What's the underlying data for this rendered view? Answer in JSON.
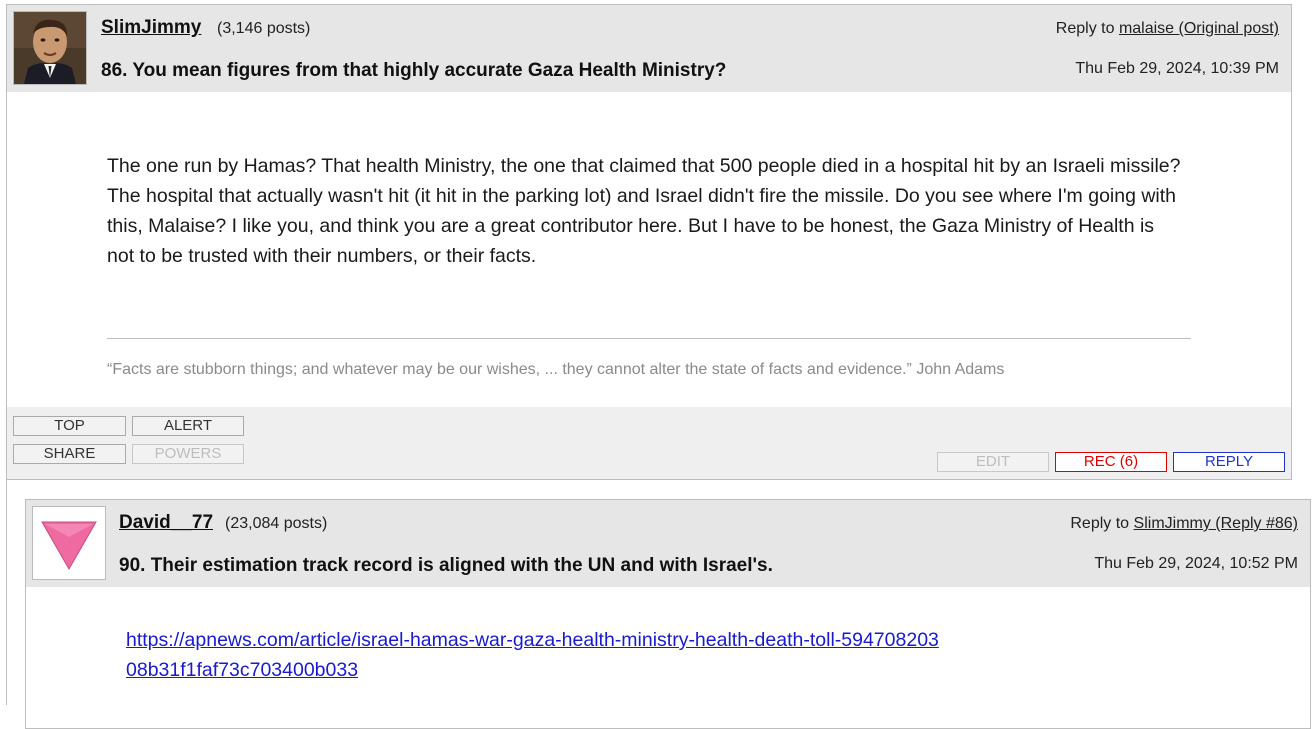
{
  "posts": [
    {
      "username": "SlimJimmy",
      "post_count": "(3,146 posts)",
      "reply_prefix": "Reply to",
      "reply_link": "malaise (Original post)",
      "title": "86. You mean figures from that highly accurate Gaza Health Ministry?",
      "date": "Thu Feb 29, 2024, 10:39 PM",
      "body": "The one run by Hamas? That health Ministry, the one that claimed that 500 people died in a hospital hit by an Israeli missile? The hospital that actually wasn't hit (it hit in the parking lot) and Israel didn't fire the missile. Do you see where I'm going with this, Malaise? I like you, and think you are a great contributor here. But I have to be honest, the Gaza Ministry of Health is not to be trusted with their numbers, or their facts.",
      "signature": "“Facts are stubborn things; and whatever may be our wishes, ... they cannot alter the state of facts and evidence.” John Adams",
      "buttons": {
        "top": "TOP",
        "alert": "ALERT",
        "share": "SHARE",
        "powers": "POWERS",
        "edit": "EDIT",
        "rec": "REC (6)",
        "reply": "REPLY"
      }
    },
    {
      "username": "David__77",
      "post_count": "(23,084 posts)",
      "reply_prefix": "Reply to",
      "reply_link": "SlimJimmy (Reply #86)",
      "title": "90. Their estimation track record is aligned with the UN and with Israel's.",
      "date": "Thu Feb 29, 2024, 10:52 PM",
      "link": "https://apnews.com/article/israel-hamas-war-gaza-health-ministry-health-death-toll-59470820308b31f1faf73c703400b033"
    }
  ],
  "colors": {
    "rec": "#dd0000",
    "reply": "#2233cc",
    "link": "#1a1acc",
    "triangle": "#ee6aa0"
  },
  "icons": {
    "avatar1": "portrait-avatar",
    "avatar2": "pink-triangle-icon"
  }
}
